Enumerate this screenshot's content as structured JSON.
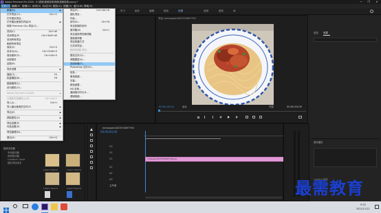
{
  "window": {
    "title": "Adobe Premiere Pro 2020 - D:\\视频\\视频剪辑\\视频\\视频剪辑.prproj *",
    "controls": [
      "—",
      "❐",
      "✕"
    ]
  },
  "menubar": [
    "文件(F)",
    "编辑(E)",
    "剪辑(C)",
    "序列(S)",
    "标记(M)",
    "图形(G)",
    "视图(V)",
    "窗口(W)",
    "帮助(H)"
  ],
  "workspaces": [
    "学习",
    "组件",
    "编辑",
    "颜色",
    "效果",
    "音频",
    "图形",
    "库"
  ],
  "file_menu": [
    {
      "label": "新建(N)",
      "arrow": true,
      "highlight": true
    },
    {
      "label": "打开项目(O)...",
      "shortcut": "Ctrl+O"
    },
    {
      "label": "打开团队项目..."
    },
    {
      "label": "打开最近使用的内容(E)",
      "arrow": true
    },
    {
      "label": "转换 Premiere Clip 项目(C)..."
    },
    {
      "sep": true
    },
    {
      "label": "关闭(C)",
      "shortcut": "Ctrl+W"
    },
    {
      "label": "关闭项目(P)",
      "shortcut": "Ctrl+Shift+W"
    },
    {
      "label": "关闭所有项目"
    },
    {
      "label": "刷新所有项目"
    },
    {
      "label": "保存(S)",
      "shortcut": "Ctrl+S"
    },
    {
      "label": "另存为(A)...",
      "shortcut": "Ctrl+Shift+S"
    },
    {
      "label": "保存副本(Y)...",
      "shortcut": "Ctrl+Alt+S"
    },
    {
      "label": "全部保存"
    },
    {
      "label": "还原(R)"
    },
    {
      "sep": true
    },
    {
      "label": "同步设置",
      "arrow": true
    },
    {
      "sep": true
    },
    {
      "label": "捕捉(T)...",
      "shortcut": "F5"
    },
    {
      "label": "批量捕捉(B)...",
      "shortcut": "F6"
    },
    {
      "sep": true
    },
    {
      "label": "链接媒体(L)..."
    },
    {
      "label": "设为脱机(O)..."
    },
    {
      "sep": true
    },
    {
      "label": "Adobe Dynamic Link(K)",
      "arrow": true,
      "disabled": true
    },
    {
      "sep": true
    },
    {
      "label": "从媒体浏览器导入(M)",
      "shortcut": "Ctrl+Alt+I",
      "disabled": true
    },
    {
      "label": "导入(I)...",
      "shortcut": "Ctrl+I"
    },
    {
      "label": "导入最近使用的文件(F)",
      "arrow": true
    },
    {
      "sep": true
    },
    {
      "label": "导出(E)",
      "arrow": true
    },
    {
      "sep": true
    },
    {
      "label": "获取属性(G)",
      "arrow": true
    },
    {
      "sep": true
    },
    {
      "label": "项目设置(P)",
      "arrow": true
    },
    {
      "label": "作品设置(R)",
      "arrow": true
    },
    {
      "sep": true
    },
    {
      "label": "项目管理(M)..."
    },
    {
      "sep": true
    },
    {
      "label": "退出(X)",
      "shortcut": "Ctrl+Q"
    }
  ],
  "new_submenu": [
    {
      "label": "项目(P)...",
      "shortcut": "Ctrl+Alt+N"
    },
    {
      "label": "团队项目..."
    },
    {
      "label": "作品..."
    },
    {
      "label": "序列(S)...",
      "shortcut": "Ctrl+N"
    },
    {
      "label": "来自剪辑的序列"
    },
    {
      "label": "素材箱(B)",
      "shortcut": "Ctrl+/"
    },
    {
      "label": "来自选择项的素材箱"
    },
    {
      "label": "搜索素材箱"
    },
    {
      "label": "项目快捷方式"
    },
    {
      "label": "已共享项目..."
    },
    {
      "label": "链接的团队项目...",
      "disabled": true
    },
    {
      "sep": true
    },
    {
      "label": "脱机文件(O)..."
    },
    {
      "label": "调整图层(A)..."
    },
    {
      "label": "旧版标题(T)...",
      "highlight": true
    },
    {
      "label": "Photoshop 文件(H)..."
    },
    {
      "sep": true
    },
    {
      "label": "彩条..."
    },
    {
      "label": "黑场视频..."
    },
    {
      "label": "字幕..."
    },
    {
      "label": "颜色遮罩..."
    },
    {
      "label": "HD 彩条..."
    },
    {
      "label": "通用倒计时片头..."
    },
    {
      "label": "透明视频..."
    }
  ],
  "program_monitor": {
    "title": "节目: mmexport1637070697790",
    "timecode_left": "00;00;00;00",
    "fit": "适合",
    "quality": "完整",
    "timecode_right": "00;00;03;00"
  },
  "right_panel": {
    "top_title": "",
    "tabs": [
      "信息",
      "效果"
    ],
    "effects_title": "基本图形",
    "lumetri": "Lumetri 颜色"
  },
  "project_panel": {
    "title": "项目: 视频剪辑",
    "items": [
      {
        "label": "mmexport1637…"
      },
      {
        "label": "视频剪辑"
      },
      {
        "label": "mmexport1637…"
      },
      {
        "label": "视频剪辑"
      }
    ],
    "media_browser": "媒体浏览器",
    "tree_items": [
      "本地驱动器",
      "网络驱动器",
      "Creative Cloud",
      "团队项目版本"
    ]
  },
  "timeline": {
    "title": "mmexport1637070697790",
    "timecode": "00;00;00;00",
    "clip_label": "mmexport1637070697790.jpg",
    "tracks": [
      "V3",
      "V2",
      "V1",
      "A1",
      "A2",
      "A3",
      "主声道"
    ]
  },
  "taskbar": {
    "time": "9:22",
    "date": "2021/11/12"
  },
  "watermark": "最需教育",
  "colors": {
    "accent": "#2d6ca3",
    "menu_highlight": "#91c9f7",
    "clip": "#e29ad7",
    "timecode": "#3d8bd8",
    "watermark": "#1a3fd0"
  }
}
